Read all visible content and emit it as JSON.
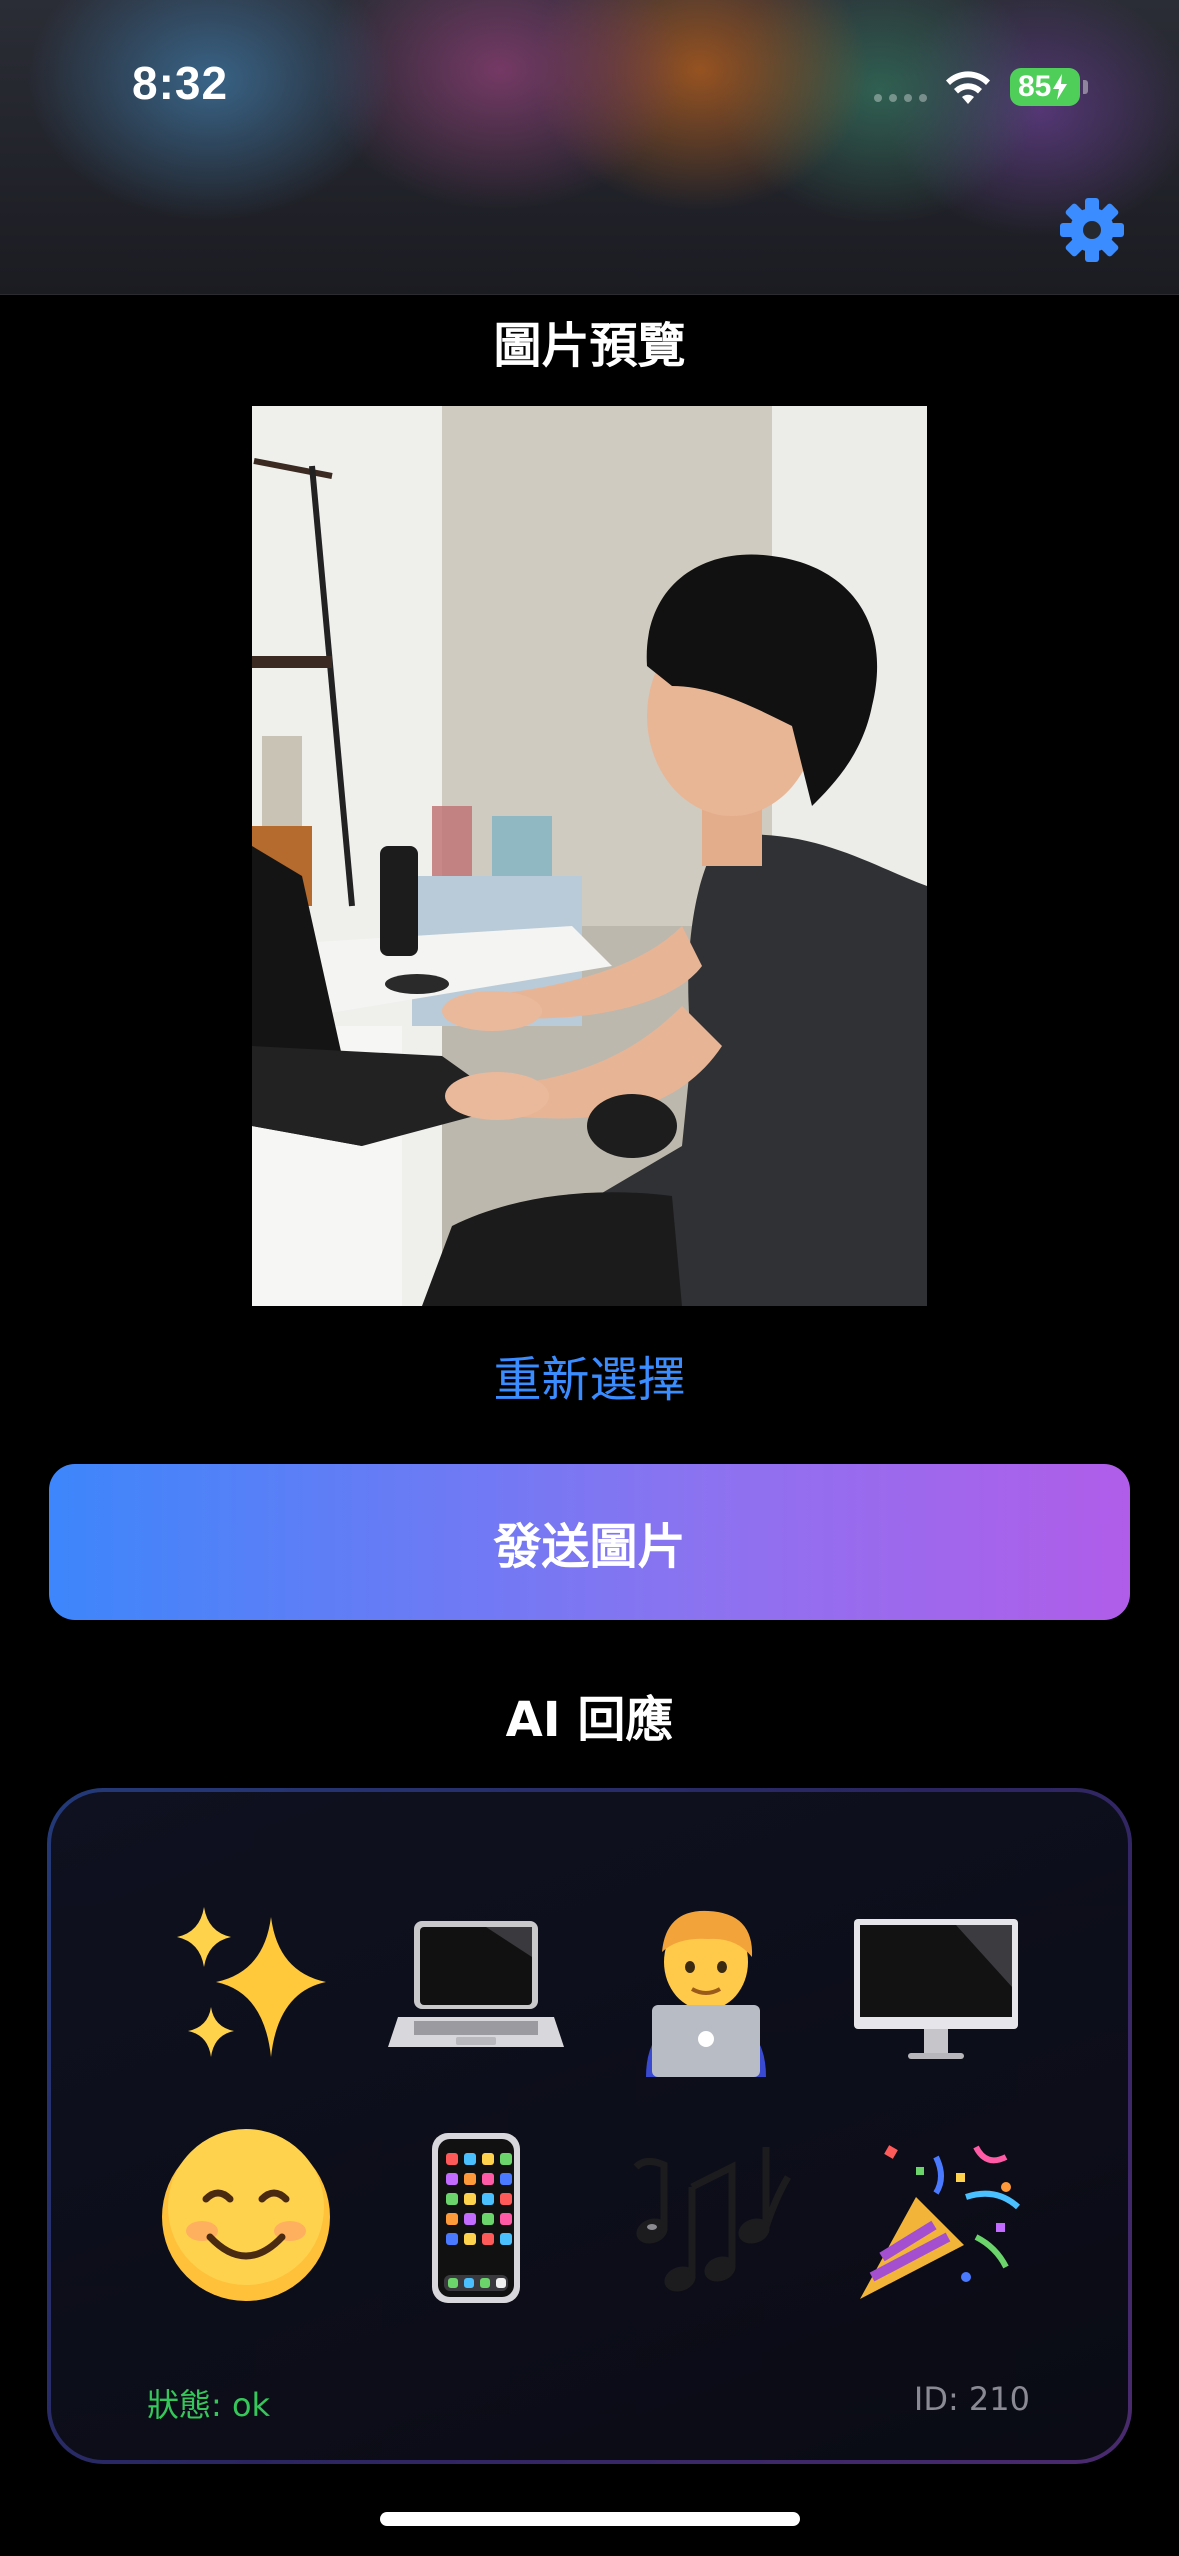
{
  "status_bar": {
    "time": "8:32",
    "battery": "85"
  },
  "header": {
    "settings_icon": "gear-icon",
    "accent_color": "#3a8cff"
  },
  "preview": {
    "title": "圖片預覽",
    "reselect_label": "重新選擇"
  },
  "send_button": {
    "label": "發送圖片"
  },
  "ai": {
    "title": "AI 回應",
    "emojis": [
      "sparkles",
      "laptop",
      "technologist",
      "desktop-computer",
      "smiling-face",
      "mobile-phone",
      "musical-notes",
      "party-popper"
    ],
    "status": "狀態: ok",
    "id": "ID: 210"
  },
  "colors": {
    "status_ok": "#35c759",
    "button_gradient_start": "#3d86fb",
    "button_gradient_end": "#b05de9"
  }
}
